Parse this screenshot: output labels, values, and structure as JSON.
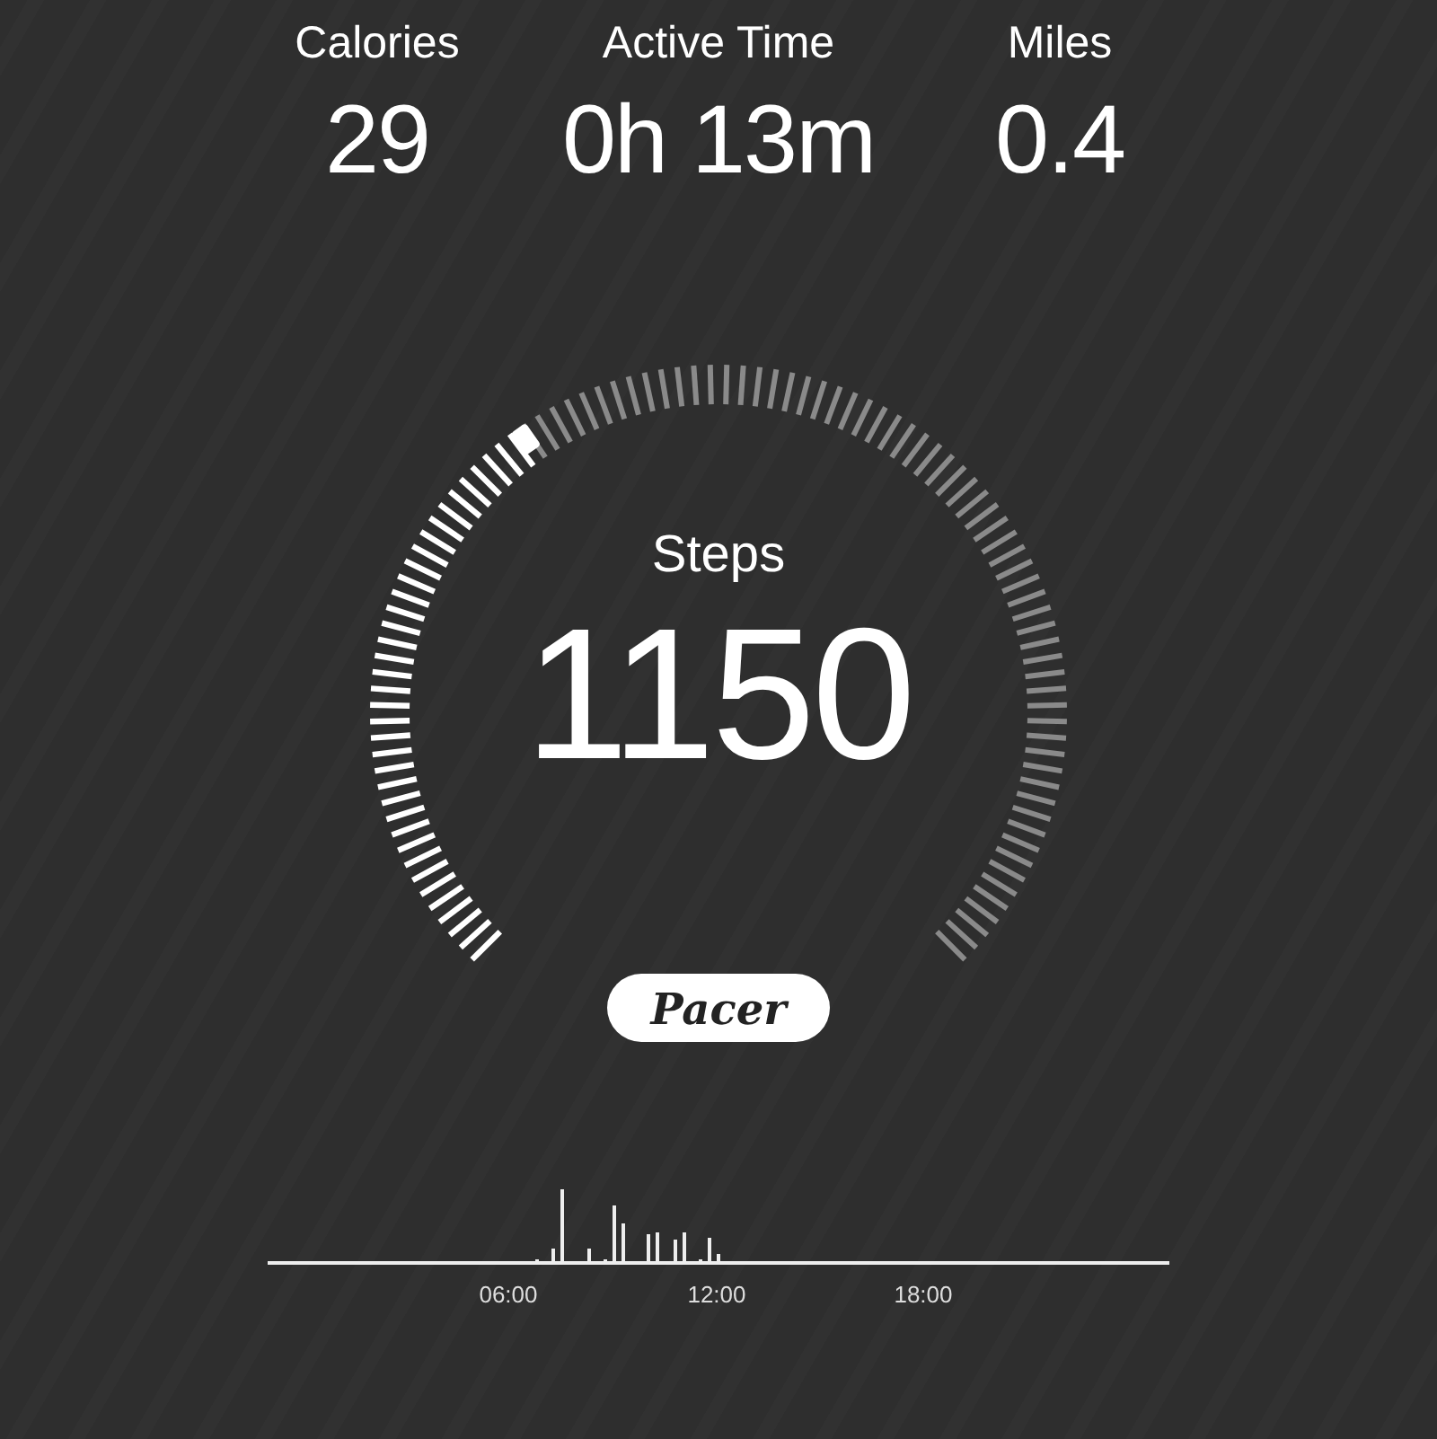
{
  "stats": [
    {
      "label": "Calories",
      "value": "29"
    },
    {
      "label": "Active Time",
      "value": "0h 13m"
    },
    {
      "label": "Miles",
      "value": "0.4"
    }
  ],
  "gauge": {
    "label": "Steps",
    "value": "1150"
  },
  "brand": {
    "logo": "Pacer"
  },
  "activity_chart": {
    "x_labels": [
      "06:00",
      "12:00",
      "18:00"
    ]
  }
}
